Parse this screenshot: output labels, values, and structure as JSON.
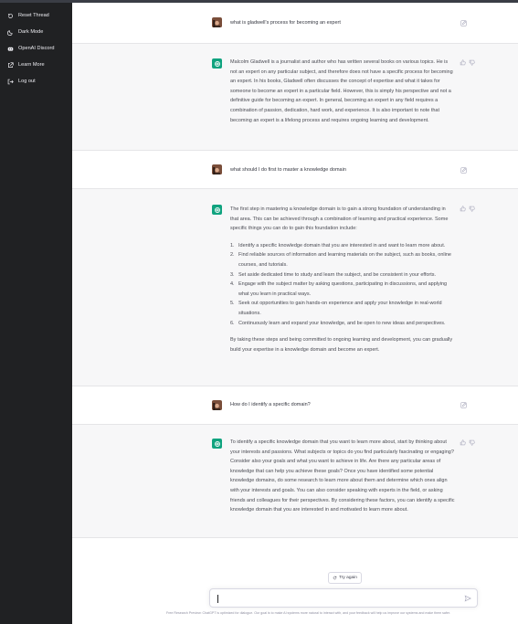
{
  "sidebar": {
    "items": [
      {
        "label": "Reset Thread",
        "icon": "reset-icon"
      },
      {
        "label": "Dark Mode",
        "icon": "moon-icon"
      },
      {
        "label": "OpenAI Discord",
        "icon": "discord-icon"
      },
      {
        "label": "Learn More",
        "icon": "external-link-icon"
      },
      {
        "label": "Log out",
        "icon": "logout-icon"
      }
    ]
  },
  "conversation": {
    "q1": "what is gladwell's process for becoming an expert",
    "a1": "Malcolm Gladwell is a journalist and author who has written several books on various topics. He is not an expert on any particular subject, and therefore does not have a specific process for becoming an expert. In his books, Gladwell often discusses the concept of expertise and what it takes for someone to become an expert in a particular field. However, this is simply his perspective and not a definitive guide for becoming an expert. In general, becoming an expert in any field requires a combination of passion, dedication, hard work, and experience. It is also important to note that becoming an expert is a lifelong process and requires ongoing learning and development.",
    "q2": "what should I do first to master a knowledge domain",
    "a2": {
      "intro": "The first step in mastering a knowledge domain is to gain a strong foundation of understanding in that area. This can be achieved through a combination of learning and practical experience. Some specific things you can do to gain this foundation include:",
      "items": [
        {
          "n": "1.",
          "text": "Identify a specific knowledge domain that you are interested in and want to learn more about."
        },
        {
          "n": "2.",
          "text": "Find reliable sources of information and learning materials on the subject, such as books, online courses, and tutorials."
        },
        {
          "n": "3.",
          "text": "Set aside dedicated time to study and learn the subject, and be consistent in your efforts."
        },
        {
          "n": "4.",
          "text": "Engage with the subject matter by asking questions, participating in discussions, and applying what you learn in practical ways."
        },
        {
          "n": "5.",
          "text": "Seek out opportunities to gain hands-on experience and apply your knowledge in real-world situations."
        },
        {
          "n": "6.",
          "text": "Continuously learn and expand your knowledge, and be open to new ideas and perspectives."
        }
      ],
      "outro": "By taking these steps and being committed to ongoing learning and development, you can gradually build your expertise in a knowledge domain and become an expert."
    },
    "q3": "How do I identify a specific domain?",
    "a3": "To identify a specific knowledge domain that you want to learn more about, start by thinking about your interests and passions. What subjects or topics do you find particularly fascinating or engaging? Consider also your goals and what you want to achieve in life. Are there any particular areas of knowledge that can help you achieve these goals? Once you have identified some potential knowledge domains, do some research to learn more about them and determine which ones align with your interests and goals. You can also consider speaking with experts in the field, or asking friends and colleagues for their perspectives. By considering these factors, you can identify a specific knowledge domain that you are interested in and motivated to learn more about."
  },
  "retry_label": "Try again",
  "input": {
    "value": "",
    "placeholder": ""
  },
  "footer": "Free Research Preview: ChatGPT is optimized for dialogue. Our goal is to make AI systems more natural to interact with, and your feedback will help us improve our systems and make them safer.",
  "colors": {
    "sidebar_bg": "#202123",
    "bot_bg": "#f7f7f8",
    "accent": "#10a37f"
  }
}
